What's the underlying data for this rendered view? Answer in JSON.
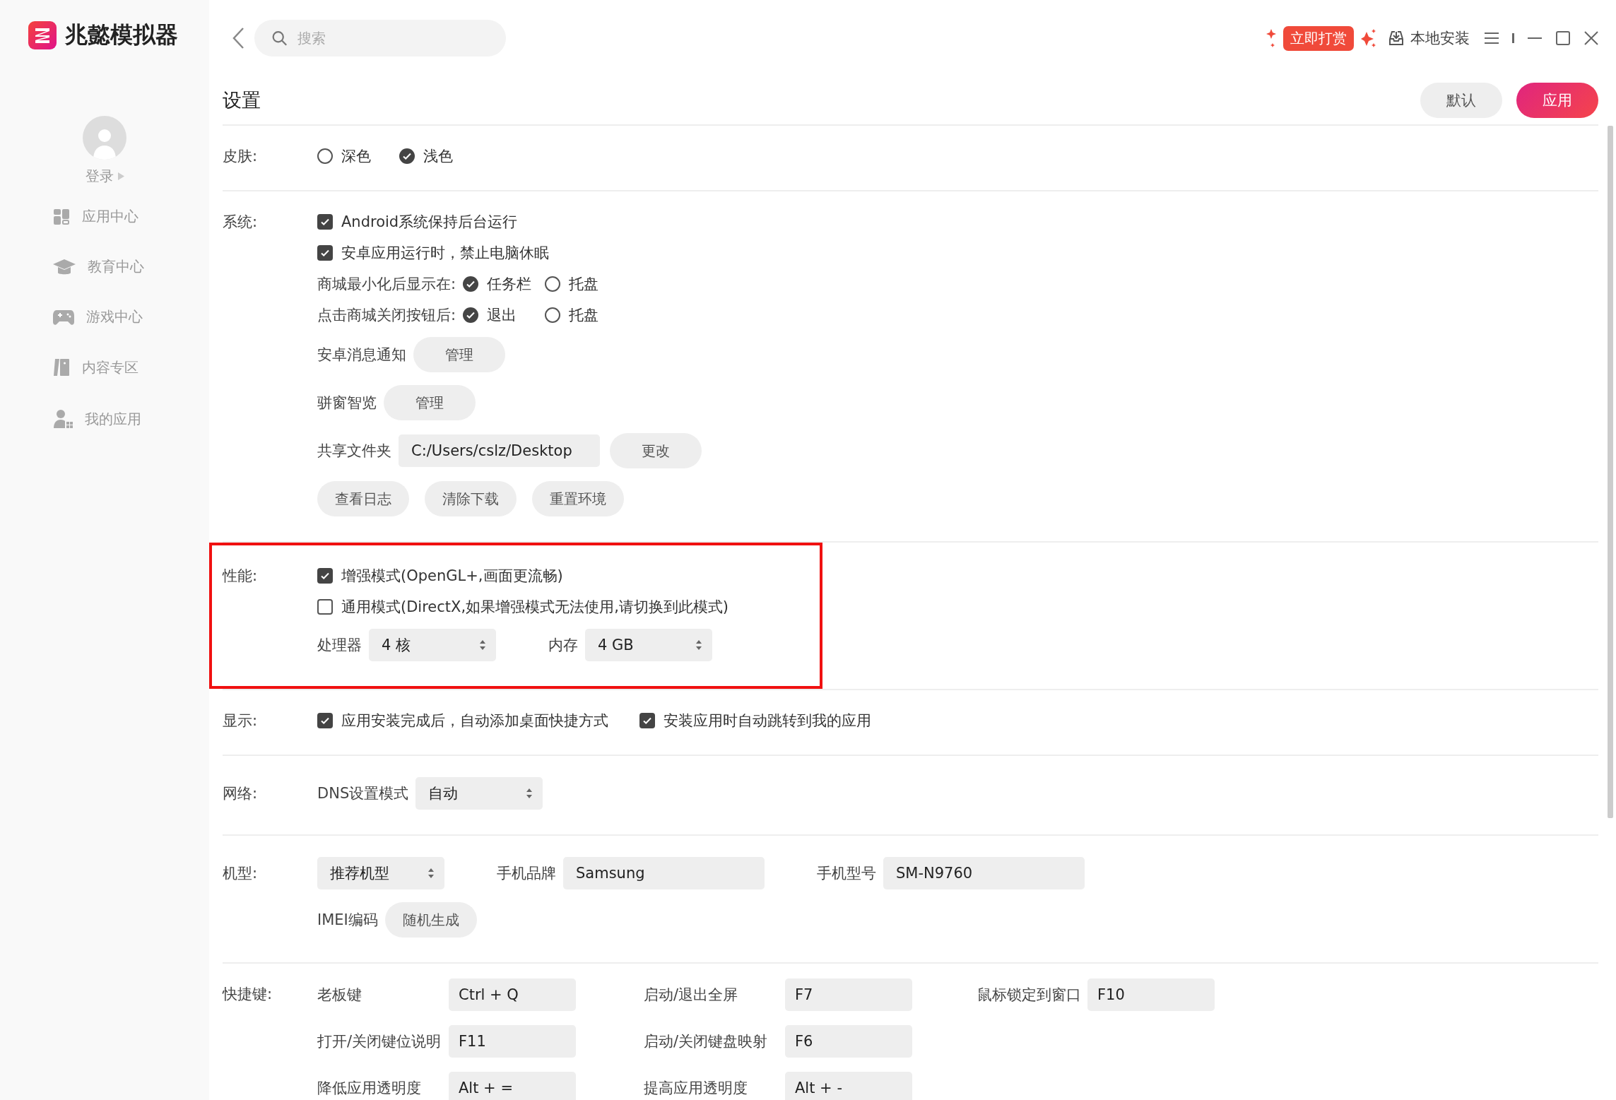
{
  "app": {
    "name": "兆懿模拟器"
  },
  "sidebar": {
    "login": "登录",
    "items": [
      {
        "label": "应用中心"
      },
      {
        "label": "教育中心"
      },
      {
        "label": "游戏中心"
      },
      {
        "label": "内容专区"
      },
      {
        "label": "我的应用"
      }
    ]
  },
  "search": {
    "placeholder": "搜索"
  },
  "toolbar": {
    "reward": "立即打赏",
    "local_install": "本地安装"
  },
  "page": {
    "title": "设置",
    "buttons": [
      {
        "label": "默认",
        "kind": "secondary"
      },
      {
        "label": "应用",
        "kind": "primary"
      }
    ]
  },
  "sections": [
    {
      "label": "皮肤:",
      "highlighted": false,
      "rows": [
        [
          {
            "kind": "radio",
            "label": "深色",
            "selected": false
          },
          {
            "kind": "radio",
            "label": "浅色",
            "selected": true
          }
        ]
      ]
    },
    {
      "label": "系统:",
      "highlighted": false,
      "rows": [
        [
          {
            "kind": "checkbox",
            "label": "Android系统保持后台运行",
            "checked": true
          }
        ],
        [
          {
            "kind": "checkbox",
            "label": "安卓应用运行时，禁止电脑休眠",
            "checked": true
          }
        ],
        [
          {
            "kind": "text",
            "text": "商城最小化后显示在:"
          },
          {
            "kind": "radio",
            "label": "任务栏",
            "selected": true
          },
          {
            "kind": "radio",
            "label": "托盘",
            "selected": false
          }
        ],
        [
          {
            "kind": "text",
            "text": "点击商城关闭按钮后:"
          },
          {
            "kind": "radio",
            "label": "退出",
            "selected": true
          },
          {
            "kind": "radio",
            "label": "托盘",
            "selected": false
          }
        ],
        [
          {
            "kind": "text",
            "text": "安卓消息通知"
          },
          {
            "kind": "button",
            "label": "管理"
          }
        ],
        [
          {
            "kind": "text",
            "text": "骈窗智览"
          },
          {
            "kind": "button",
            "label": "管理"
          }
        ],
        [
          {
            "kind": "text",
            "text": "共享文件夹"
          },
          {
            "kind": "input",
            "value": "C:/Users/cslz/Desktop"
          },
          {
            "kind": "button",
            "label": "更改"
          }
        ],
        [
          {
            "kind": "button",
            "label": "查看日志"
          },
          {
            "kind": "button",
            "label": "清除下载"
          },
          {
            "kind": "button",
            "label": "重置环境"
          }
        ]
      ]
    },
    {
      "label": "性能:",
      "highlighted": true,
      "rows": [
        [
          {
            "kind": "checkbox",
            "label": "增强模式(OpenGL+,画面更流畅)",
            "checked": true
          }
        ],
        [
          {
            "kind": "checkbox",
            "label": "通用模式(DirectX,如果增强模式无法使用,请切换到此模式)",
            "checked": false
          }
        ],
        [
          {
            "kind": "text",
            "text": "处理器"
          },
          {
            "kind": "select",
            "value": "4 核"
          },
          {
            "kind": "text",
            "text": "内存"
          },
          {
            "kind": "select",
            "value": "4 GB"
          }
        ]
      ]
    },
    {
      "label": "显示:",
      "highlighted": false,
      "rows": [
        [
          {
            "kind": "checkbox",
            "label": "应用安装完成后，自动添加桌面快捷方式",
            "checked": true
          },
          {
            "kind": "checkbox",
            "label": "安装应用时自动跳转到我的应用",
            "checked": true
          }
        ]
      ]
    },
    {
      "label": "网络:",
      "highlighted": false,
      "rows": [
        [
          {
            "kind": "text",
            "text": "DNS设置模式"
          },
          {
            "kind": "select",
            "value": "自动"
          }
        ]
      ]
    },
    {
      "label": "机型:",
      "highlighted": false,
      "rows": [
        [
          {
            "kind": "select",
            "value": "推荐机型"
          },
          {
            "kind": "text",
            "text": "手机品牌"
          },
          {
            "kind": "input",
            "value": "Samsung"
          },
          {
            "kind": "text",
            "text": "手机型号"
          },
          {
            "kind": "input",
            "value": "SM-N9760"
          }
        ],
        [
          {
            "kind": "text",
            "text": "IMEI编码"
          },
          {
            "kind": "button",
            "label": "随机生成"
          }
        ]
      ]
    }
  ],
  "shortcuts": {
    "label": "快捷键:",
    "rows": [
      [
        {
          "label": "老板键",
          "value": "Ctrl + Q"
        },
        {
          "label": "启动/退出全屏",
          "value": "F7"
        },
        {
          "label": "鼠标锁定到窗口",
          "value": "F10"
        }
      ],
      [
        {
          "label": "打开/关闭键位说明",
          "value": "F11"
        },
        {
          "label": "启动/关闭键盘映射",
          "value": "F6"
        }
      ],
      [
        {
          "label": "降低应用透明度",
          "value": "Alt + ="
        },
        {
          "label": "提高应用透明度",
          "value": "Alt + -"
        }
      ]
    ]
  }
}
